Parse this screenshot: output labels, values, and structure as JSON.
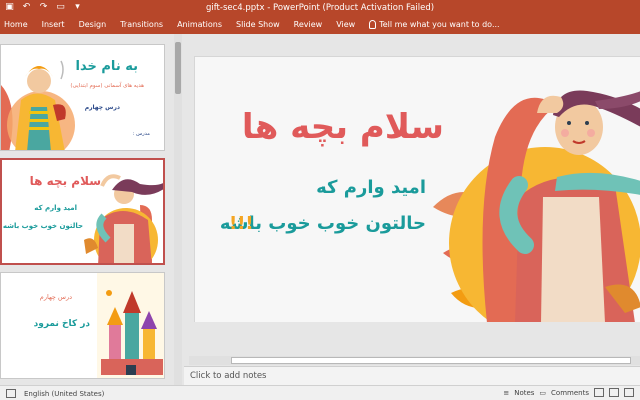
{
  "window": {
    "title": "gift-sec4.pptx - PowerPoint (Product Activation Failed)",
    "accent": "#b7472a"
  },
  "ribbon": {
    "tabs": [
      "Home",
      "Insert",
      "Design",
      "Transitions",
      "Animations",
      "Slide Show",
      "Review",
      "View"
    ],
    "tell_me": "Tell me what you want to do..."
  },
  "thumbnails": {
    "t1": {
      "title": "به نام خدا",
      "subtitle": "هدیه های آسمانی (سوم ابتدایی)",
      "lesson": "درس چهارم",
      "teacher": "مدرس :"
    },
    "t2": {
      "title": "سلام بچه ها",
      "line1": "امید وارم که",
      "line2": "حالتون خوب خوب باشه !!!"
    },
    "t3": {
      "lesson": "درس چهارم",
      "title": "در کاخ نمرود"
    }
  },
  "slide": {
    "title": "سلام بچه ها",
    "line1": "امید وارم که",
    "line2": "حالتون خوب خوب باشه",
    "exclaim": "!!!",
    "colors": {
      "title": "#e05a5a",
      "teal": "#1a9b9b",
      "orange": "#f5a623"
    }
  },
  "notes": {
    "placeholder": "Click to add notes"
  },
  "status": {
    "language": "English (United States)",
    "notes_label": "Notes",
    "comments_label": "Comments"
  }
}
